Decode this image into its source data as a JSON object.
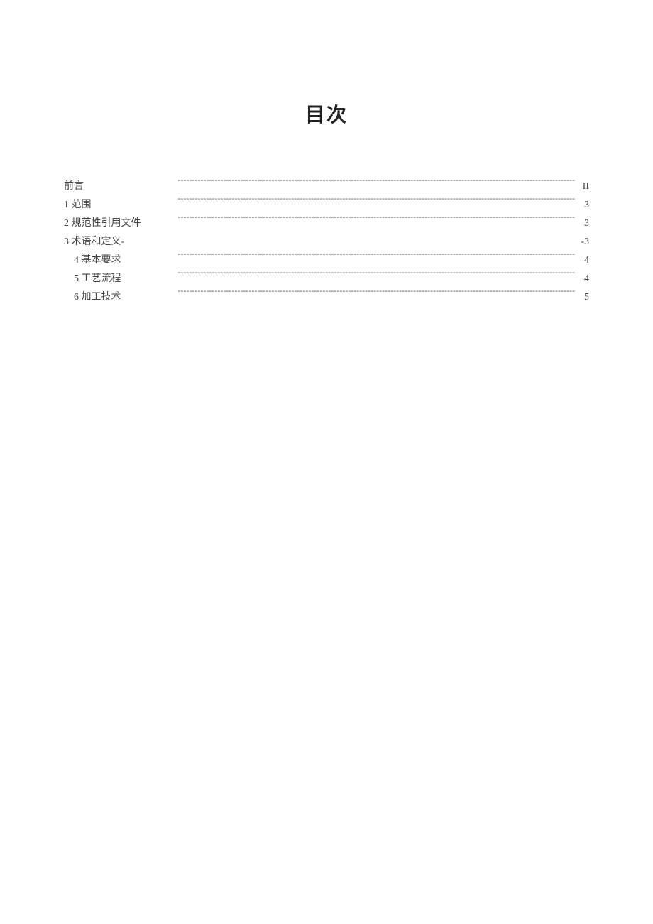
{
  "title": "目次",
  "toc": [
    {
      "label": "前言",
      "page": "II",
      "indent": false
    },
    {
      "label": "1 范围",
      "page": "3",
      "indent": false
    },
    {
      "label": "2 规范性引用文件",
      "page": "3",
      "indent": false
    },
    {
      "label": "3 术语和定义-",
      "page": "-3",
      "indent": false
    },
    {
      "label": "4 基本要求",
      "page": "4",
      "indent": true
    },
    {
      "label": "5 工艺流程",
      "page": "4",
      "indent": true
    },
    {
      "label": "6 加工技术",
      "page": "5",
      "indent": true
    }
  ]
}
